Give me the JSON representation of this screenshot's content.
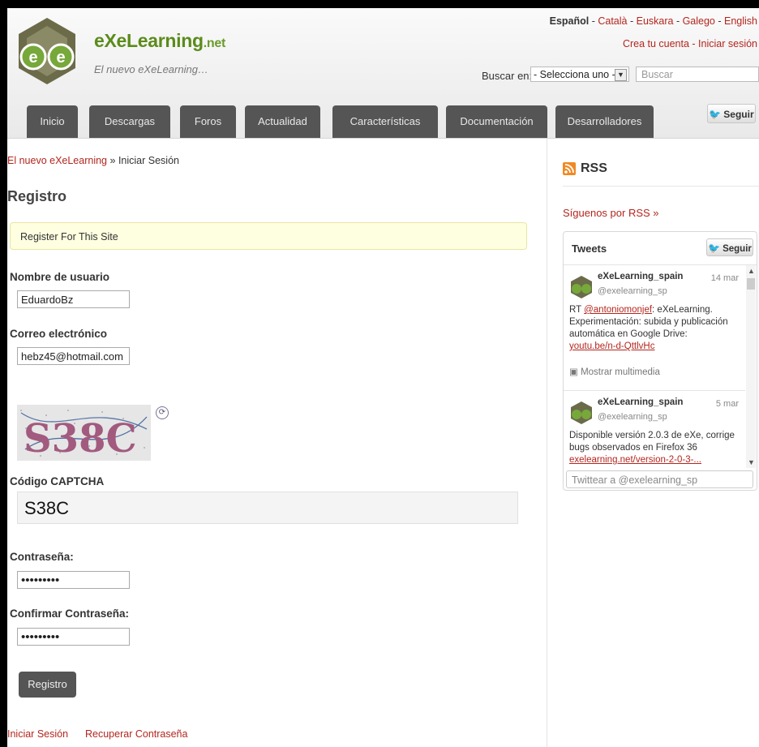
{
  "header": {
    "site_name": "eXeLearning",
    "site_suffix": ".net",
    "slogan": "El nuevo eXeLearning…",
    "languages": [
      "Español",
      "Català",
      "Euskara",
      "Galego",
      "English"
    ],
    "account_links": [
      "Crea tu cuenta",
      "Iniciar sesión"
    ],
    "search": {
      "label": "Buscar en:",
      "select_value": "- Selecciona uno -",
      "placeholder": "Buscar"
    },
    "seguir_label": "Seguir"
  },
  "nav": {
    "tabs": [
      "Inicio",
      "Descargas",
      "Foros",
      "Actualidad",
      "Características",
      "Documentación",
      "Desarrolladores"
    ]
  },
  "breadcrumb": {
    "link": "El nuevo eXeLearning",
    "separator": "»",
    "current": "Iniciar Sesión"
  },
  "form": {
    "title": "Registro",
    "notice": "Register For This Site",
    "username_label": "Nombre de usuario",
    "username_value": "EduardoBz",
    "email_label": "Correo electrónico",
    "email_value": "hebz45@hotmail.com",
    "captcha_text": "S38C",
    "captcha_label": "Código CAPTCHA",
    "captcha_value": "S38C",
    "password_label": "Contraseña:",
    "password_value": "•••••••••",
    "confirm_label": "Confirmar Contraseña:",
    "confirm_value": "•••••••••",
    "submit_label": "Registro",
    "footer_links": [
      "Iniciar Sesión",
      "Recuperar Contraseña"
    ]
  },
  "sidebar": {
    "rss_title": "RSS",
    "rss_link": "Síguenos por RSS »",
    "twitter": {
      "title": "Tweets",
      "seguir_label": "Seguir",
      "tweets": [
        {
          "name": "eXeLearning_spain",
          "handle": "@exelearning_sp",
          "date": "14 mar",
          "text_pre": "RT ",
          "mention": "@antoniomonjef",
          "text": ": eXeLearning. Experimentación: subida y publicación automática en Google Drive:",
          "link": "youtu.be/n-d-QttlvHc",
          "media": "Mostrar multimedia"
        },
        {
          "name": "eXeLearning_spain",
          "handle": "@exelearning_sp",
          "date": "5 mar",
          "text": "Disponible versión 2.0.3 de eXe, corrige bugs observados en Firefox 36",
          "link": "exelearning.net/version-2-0-3-..."
        }
      ],
      "compose_placeholder": "Twittear a @exelearning_sp"
    }
  },
  "colors": {
    "brand_green": "#5b8b1b",
    "link_red": "#b3261e",
    "tab_gray": "#555555",
    "notice_bg": "#fefee0"
  }
}
